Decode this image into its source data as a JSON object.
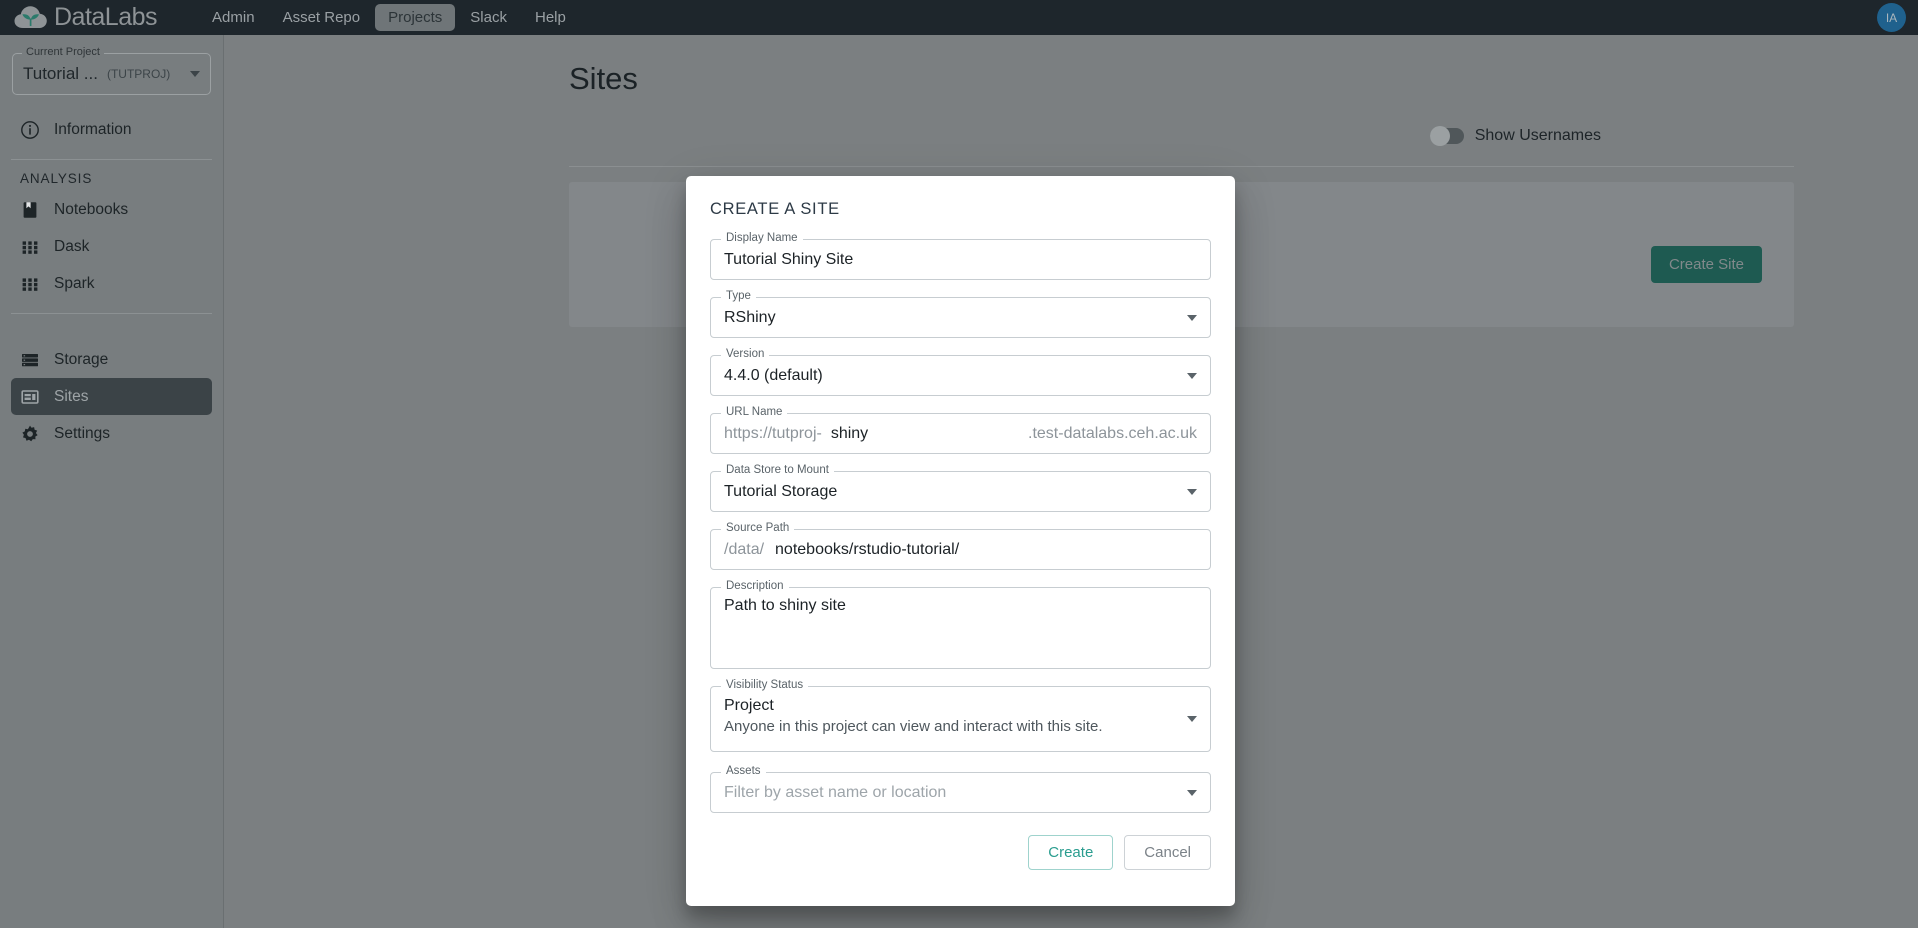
{
  "topbar": {
    "logo_text": "DataLabs",
    "logo_icon": "cloud-plant-logo-icon",
    "nav": [
      {
        "label": "Admin",
        "active": false
      },
      {
        "label": "Asset Repo",
        "active": false
      },
      {
        "label": "Projects",
        "active": true
      },
      {
        "label": "Slack",
        "active": false
      },
      {
        "label": "Help",
        "active": false
      }
    ],
    "avatar_initials": "IA"
  },
  "sidebar": {
    "project": {
      "legend": "Current Project",
      "name": "Tutorial ...",
      "code": "(TUTPROJ)"
    },
    "information": {
      "label": "Information",
      "icon": "info-circle-icon"
    },
    "analysis_heading": "ANALYSIS",
    "analysis_items": [
      {
        "label": "Notebooks",
        "icon": "notebook-icon",
        "selected": false
      },
      {
        "label": "Dask",
        "icon": "grid-icon",
        "selected": false
      },
      {
        "label": "Spark",
        "icon": "grid-icon",
        "selected": false
      }
    ],
    "resource_items": [
      {
        "label": "Storage",
        "icon": "storage-stack-icon",
        "selected": false
      },
      {
        "label": "Sites",
        "icon": "sites-layout-icon",
        "selected": true
      },
      {
        "label": "Settings",
        "icon": "gear-icon",
        "selected": false
      }
    ]
  },
  "main": {
    "page_title": "Sites",
    "show_usernames_label": "Show Usernames",
    "show_usernames_on": false,
    "create_site_label": "Create Site"
  },
  "modal": {
    "title": "CREATE A SITE",
    "fields": {
      "display_name": {
        "legend": "Display Name",
        "value": "Tutorial Shiny Site"
      },
      "type": {
        "legend": "Type",
        "value": "RShiny"
      },
      "version": {
        "legend": "Version",
        "value": "4.4.0  (default)"
      },
      "url_name": {
        "legend": "URL Name",
        "prefix": "https://tutproj-",
        "value": "shiny",
        "suffix": ".test-datalabs.ceh.ac.uk"
      },
      "data_store": {
        "legend": "Data Store to Mount",
        "value": "Tutorial Storage"
      },
      "source_path": {
        "legend": "Source Path",
        "prefix": "/data/",
        "value": "notebooks/rstudio-tutorial/"
      },
      "description": {
        "legend": "Description",
        "value": "Path to shiny site"
      },
      "visibility": {
        "legend": "Visibility Status",
        "value": "Project",
        "sub": "Anyone in this project can view and interact with this site."
      },
      "assets": {
        "legend": "Assets",
        "placeholder": "Filter by asset name or location"
      }
    },
    "create_label": "Create",
    "cancel_label": "Cancel"
  },
  "colors": {
    "brand_teal": "#2a9d8f",
    "topbar_bg": "#1e262c",
    "sidebar_bg": "#787d7f",
    "create_site_bg": "#1e5a51",
    "avatar_bg": "#1f618d"
  }
}
